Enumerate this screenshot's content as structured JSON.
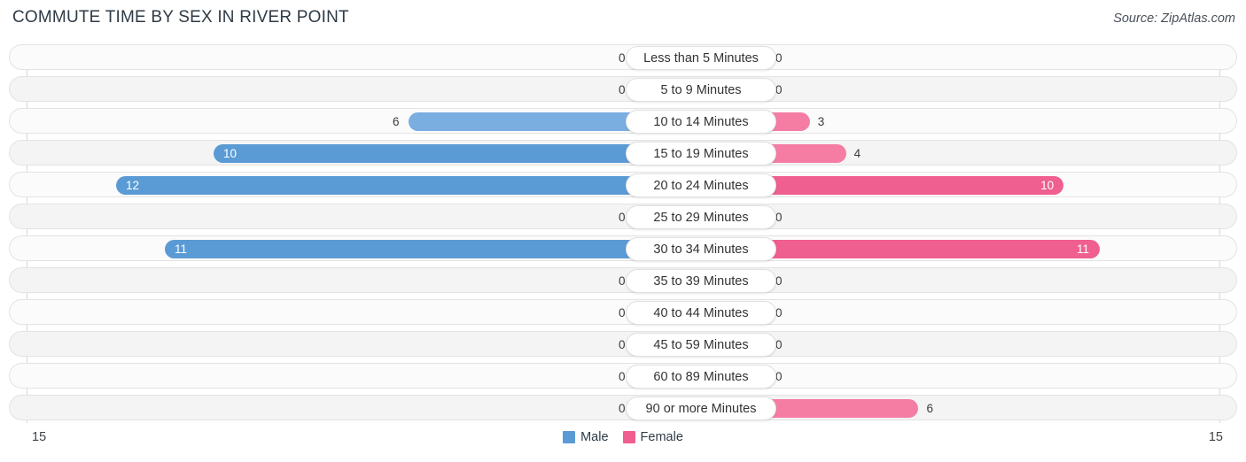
{
  "header": {
    "title": "COMMUTE TIME BY SEX IN RIVER POINT",
    "source": "Source: ZipAtlas.com"
  },
  "axis": {
    "left_tick": "15",
    "right_tick": "15"
  },
  "legend": {
    "items": [
      {
        "label": "Male",
        "color": "#5b9bd5"
      },
      {
        "label": "Female",
        "color": "#ef5f8f"
      }
    ]
  },
  "chart_data": {
    "type": "bar",
    "title": "COMMUTE TIME BY SEX IN RIVER POINT",
    "subtitle": "Source: ZipAtlas.com",
    "orientation": "horizontal-diverging",
    "xlabel": "",
    "ylabel": "",
    "axis_max": 15,
    "xlim": [
      15,
      15
    ],
    "grid": false,
    "legend_position": "bottom-center",
    "categories": [
      "Less than 5 Minutes",
      "5 to 9 Minutes",
      "10 to 14 Minutes",
      "15 to 19 Minutes",
      "20 to 24 Minutes",
      "25 to 29 Minutes",
      "30 to 34 Minutes",
      "35 to 39 Minutes",
      "40 to 44 Minutes",
      "45 to 59 Minutes",
      "60 to 89 Minutes",
      "90 or more Minutes"
    ],
    "series": [
      {
        "name": "Male",
        "color": "#5b9bd5",
        "values": [
          0,
          0,
          6,
          10,
          12,
          0,
          11,
          0,
          0,
          0,
          0,
          0
        ],
        "labels": [
          "0",
          "0",
          "6",
          "10",
          "12",
          "0",
          "11",
          "0",
          "0",
          "0",
          "0",
          "0"
        ]
      },
      {
        "name": "Female",
        "color": "#ef5f8f",
        "values": [
          0,
          0,
          3,
          4,
          10,
          0,
          11,
          0,
          0,
          0,
          0,
          6
        ],
        "labels": [
          "0",
          "0",
          "3",
          "4",
          "10",
          "0",
          "11",
          "0",
          "0",
          "0",
          "0",
          "6"
        ]
      }
    ]
  }
}
